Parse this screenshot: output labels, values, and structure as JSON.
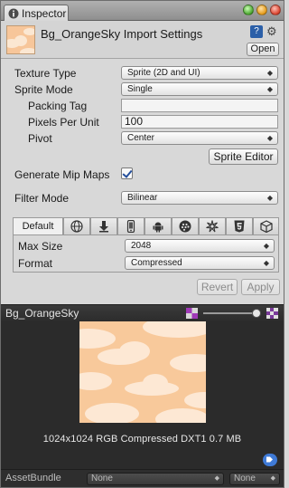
{
  "window": {
    "tab_title": "Inspector"
  },
  "header": {
    "title": "Bg_OrangeSky Import Settings",
    "open_label": "Open"
  },
  "settings": {
    "texture_type": {
      "label": "Texture Type",
      "value": "Sprite (2D and UI)"
    },
    "sprite_mode": {
      "label": "Sprite Mode",
      "value": "Single"
    },
    "packing_tag": {
      "label": "Packing Tag",
      "value": ""
    },
    "pixels_per_unit": {
      "label": "Pixels Per Unit",
      "value": "100"
    },
    "pivot": {
      "label": "Pivot",
      "value": "Center"
    },
    "sprite_editor_label": "Sprite Editor",
    "generate_mip_maps": {
      "label": "Generate Mip Maps",
      "checked": true
    },
    "filter_mode": {
      "label": "Filter Mode",
      "value": "Bilinear"
    }
  },
  "platform_tabs": {
    "default_label": "Default",
    "icons": [
      "globe-icon",
      "download-icon",
      "phone-icon",
      "android-icon",
      "blackberry-icon",
      "tizen-icon",
      "html5-icon",
      "box-icon"
    ]
  },
  "platform_settings": {
    "max_size": {
      "label": "Max Size",
      "value": "2048"
    },
    "format": {
      "label": "Format",
      "value": "Compressed"
    }
  },
  "actions": {
    "revert_label": "Revert",
    "apply_label": "Apply"
  },
  "preview": {
    "title": "Bg_OrangeSky",
    "info": "1024x1024  RGB Compressed DXT1    0.7 MB",
    "colors": {
      "sky": "#f8c99b",
      "cloud": "#fde8d4"
    }
  },
  "asset_bundle": {
    "label": "AssetBundle",
    "name_value": "None",
    "variant_value": "None"
  }
}
